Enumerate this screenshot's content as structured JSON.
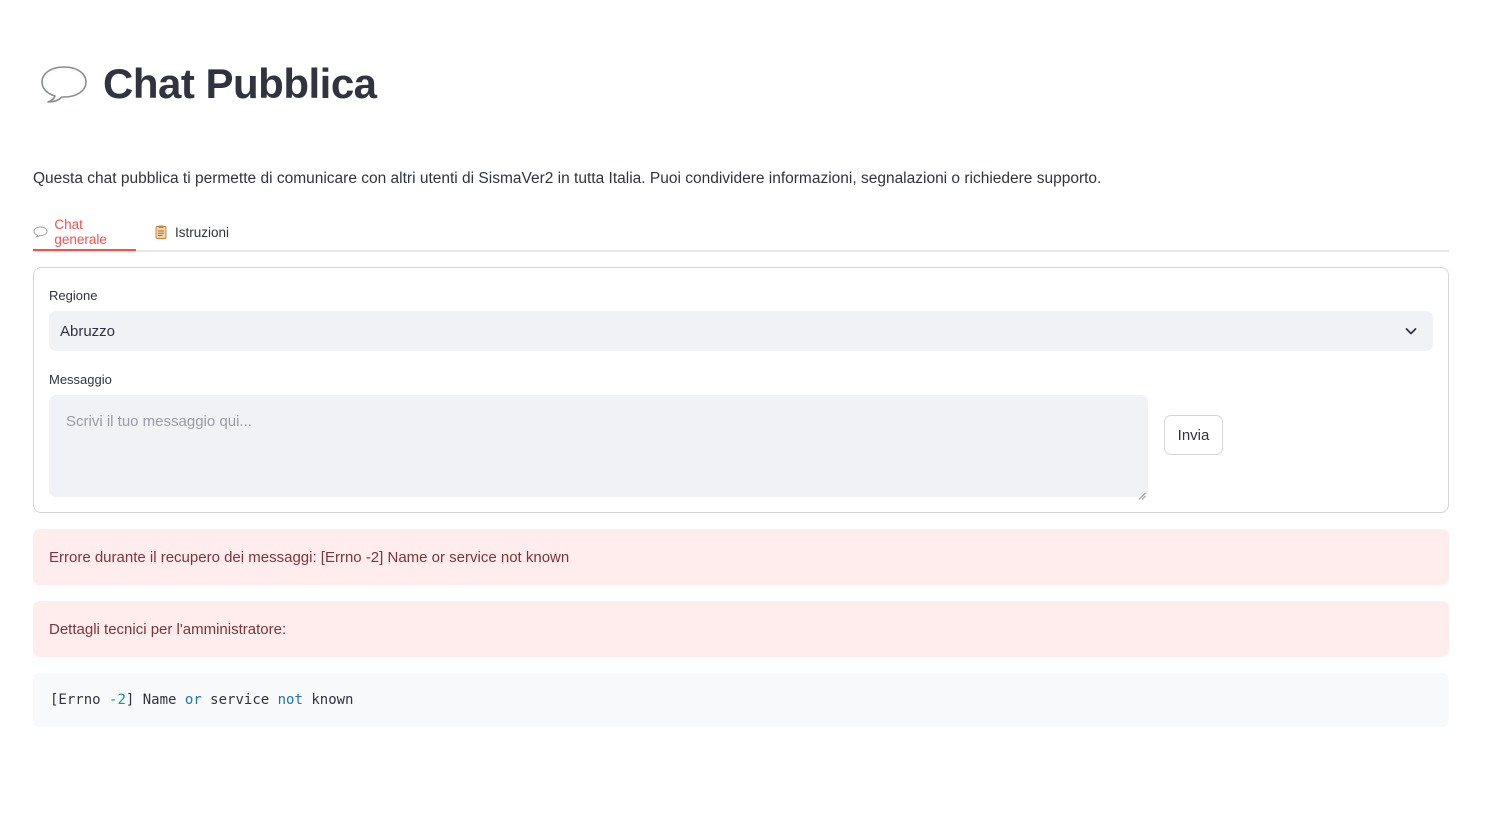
{
  "header": {
    "icon": "speech-balloon-icon",
    "title": "Chat Pubblica"
  },
  "intro_text": "Questa chat pubblica ti permette di comunicare con altri utenti di SismaVer2 in tutta Italia. Puoi condividere informazioni, segnalazioni o richiedere supporto.",
  "tabs": [
    {
      "label": "Chat generale",
      "icon": "speech-balloon-icon",
      "active": true
    },
    {
      "label": "Istruzioni",
      "icon": "clipboard-icon",
      "active": false
    }
  ],
  "form": {
    "region_label": "Regione",
    "region_value": "Abruzzo",
    "message_label": "Messaggio",
    "message_placeholder": "Scrivi il tuo messaggio qui...",
    "message_value": "",
    "send_label": "Invia"
  },
  "alerts": {
    "fetch_error": "Errore durante il recupero dei messaggi: [Errno -2] Name or service not known",
    "tech_details": "Dettagli tecnici per l'amministratore:"
  },
  "code": {
    "tokens": [
      {
        "text": "[Errno ",
        "type": "plain"
      },
      {
        "text": "-2",
        "type": "num"
      },
      {
        "text": "] Name ",
        "type": "plain"
      },
      {
        "text": "or",
        "type": "kw"
      },
      {
        "text": " service ",
        "type": "plain"
      },
      {
        "text": "not",
        "type": "kw"
      },
      {
        "text": " known",
        "type": "plain"
      }
    ]
  },
  "colors": {
    "accent": "#ff4b4b",
    "text": "#31333f",
    "input_bg": "#f0f2f6",
    "error_bg": "#ffecec",
    "error_text": "#7d353b",
    "code_bg": "#f8f9fb",
    "code_keyword": "#1a73c7",
    "code_number": "#0f9d8f"
  }
}
